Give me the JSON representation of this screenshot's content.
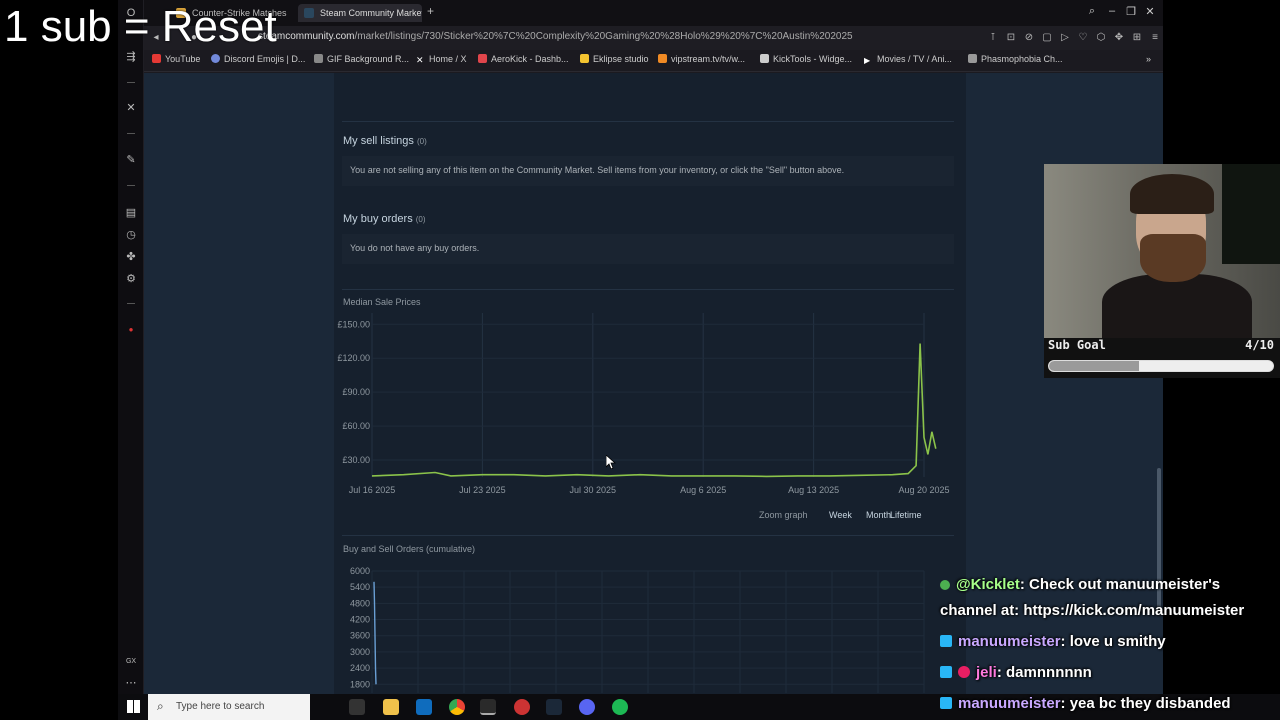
{
  "overlay": {
    "title": "1 sub = Reset"
  },
  "browser": {
    "tabs": [
      {
        "label": "Counter-Strike Matches",
        "favicon_color": "#d9a33a"
      },
      {
        "label": "Steam Community Market",
        "favicon_color": "#2a475e"
      }
    ],
    "new_tab": "+",
    "url_prefix": "steamcommunity.com",
    "url_path": "/market/listings/730/Sticker%20%7C%20Complexity%20Gaming%20%28Holo%29%20%7C%20Austin%202025",
    "bookmarks": [
      {
        "label": "YouTube",
        "color": "#e53935"
      },
      {
        "label": "Discord Emojis | D...",
        "color": "#7289da"
      },
      {
        "label": "GIF Background R...",
        "color": "#888888"
      },
      {
        "label": "Home / X",
        "color": "#ffffff"
      },
      {
        "label": "AeroKick - Dashb...",
        "color": "#e0454b"
      },
      {
        "label": "Eklipse studio",
        "color": "#f4c430"
      },
      {
        "label": "vipstream.tv/tv/w...",
        "color": "#f08a24"
      },
      {
        "label": "KickTools - Widge...",
        "color": "#cccccc"
      },
      {
        "label": "Movies / TV / Ani...",
        "color": "#ffffff"
      },
      {
        "label": "Phasmophobia Ch...",
        "color": "#999999"
      }
    ]
  },
  "steam": {
    "sell_listings": {
      "title": "My sell listings",
      "count": "(0)",
      "message": "You are not selling any of this item on the Community Market. Sell items from your inventory, or click the \"Sell\" button above."
    },
    "buy_orders": {
      "title": "My buy orders",
      "count": "(0)",
      "message": "You do not have any buy orders."
    },
    "median_chart_title": "Median Sale Prices",
    "orders_chart_title": "Buy and Sell Orders (cumulative)",
    "zoom": {
      "label": "Zoom graph",
      "options": [
        "Week",
        "Month",
        "Lifetime"
      ]
    }
  },
  "chart_data": [
    {
      "type": "line",
      "title": "Median Sale Prices",
      "x_ticks": [
        "Jul 16 2025",
        "Jul 23 2025",
        "Jul 30 2025",
        "Aug 6 2025",
        "Aug 13 2025",
        "Aug 20 2025"
      ],
      "y_ticks": [
        "£30.00",
        "£60.00",
        "£90.00",
        "£120.00",
        "£150.00"
      ],
      "ylim": [
        15,
        160
      ],
      "x": [
        "2025-07-16",
        "2025-07-18",
        "2025-07-20",
        "2025-07-21",
        "2025-07-23",
        "2025-07-25",
        "2025-07-27",
        "2025-07-29",
        "2025-07-31",
        "2025-08-02",
        "2025-08-04",
        "2025-08-06",
        "2025-08-08",
        "2025-08-10",
        "2025-08-12",
        "2025-08-14",
        "2025-08-16",
        "2025-08-18",
        "2025-08-19",
        "2025-08-19T12:00",
        "2025-08-19T18:00",
        "2025-08-20",
        "2025-08-20T06:00",
        "2025-08-20T12:00",
        "2025-08-20T18:00"
      ],
      "values": [
        16,
        17,
        19,
        16,
        17,
        17,
        16,
        17,
        16,
        17,
        16,
        16,
        16,
        15.5,
        16,
        16,
        16.5,
        17,
        18,
        25,
        133,
        50,
        35,
        55,
        40
      ],
      "grid": true
    },
    {
      "type": "line",
      "title": "Buy and Sell Orders (cumulative)",
      "y_ticks": [
        "1800",
        "2400",
        "3000",
        "3600",
        "4200",
        "4800",
        "5400",
        "6000"
      ],
      "ylim": [
        1700,
        6000
      ],
      "series": [
        {
          "values": [
            5600,
            4800,
            3600,
            2400,
            1800
          ]
        }
      ],
      "grid": true
    }
  ],
  "streamer": {
    "subgoal_label": "Sub Goal",
    "subgoal_count": "4/10",
    "subgoal_fraction": 0.4
  },
  "chat": [
    {
      "user": "@Kicklet",
      "message": ": Check out manuumeister's",
      "color": "green"
    },
    {
      "user": "",
      "message": "channel at: https://kick.com/manuumeister",
      "color": "none"
    },
    {
      "user": "manuumeister",
      "message": ": love u smithy",
      "color": "purple"
    },
    {
      "user": "jeli",
      "message": ": damnnnnnn",
      "color": "pink"
    },
    {
      "user": "manuumeister",
      "message": ": yea bc they disbanded",
      "color": "purple"
    }
  ],
  "taskbar": {
    "search_placeholder": "Type here to search"
  },
  "colors": {
    "chart_line": "#8bc34a",
    "orders_line": "#6a9fd4",
    "steam_bg": "#1b2838"
  }
}
